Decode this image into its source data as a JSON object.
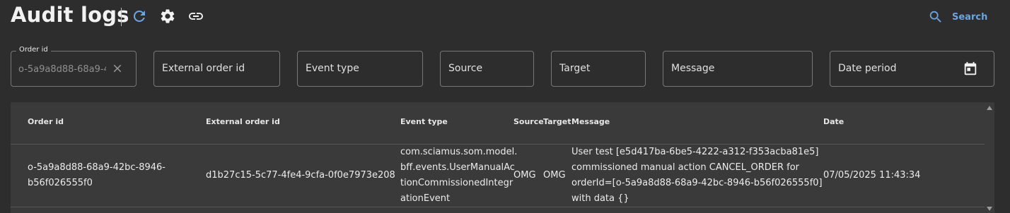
{
  "header": {
    "title": "Audit logs",
    "search_label": "Search",
    "icons": [
      "refresh-icon",
      "settings-icon",
      "link-icon",
      "search-icon"
    ],
    "accent_color": "#6ea4e0"
  },
  "filters": {
    "order_id": {
      "label": "Order id",
      "value": "o-5a9a8d88-68a9-4"
    },
    "external_order_id": "External order id",
    "event_type": "Event type",
    "source": "Source",
    "target": "Target",
    "message": "Message",
    "date_period": "Date period"
  },
  "table": {
    "columns": [
      "Order id",
      "External order id",
      "Event type",
      "Source",
      "Target",
      "Message",
      "Date"
    ],
    "rows": [
      {
        "order_id": [
          "o-5a9a8d88-68a9-42bc-8946-",
          "b56f026555f0"
        ],
        "external_order_id": "d1b27c15-5c77-4fe4-9cfa-0f0e7973e208",
        "event_type": [
          "com.sciamus.som.model.",
          "bff.events.UserManualAc",
          "tionCommissionedIntegr",
          "ationEvent"
        ],
        "source": "OMG",
        "target": "OMG",
        "message": [
          "User test [e5d417ba-6be5-4222-a312-f353acba81e5]",
          "commissioned manual action CANCEL_ORDER for",
          "orderId=[o-5a9a8d88-68a9-42bc-8946-b56f026555f0]",
          "with data {}"
        ],
        "date": "07/05/2025 11:43:34"
      }
    ]
  }
}
